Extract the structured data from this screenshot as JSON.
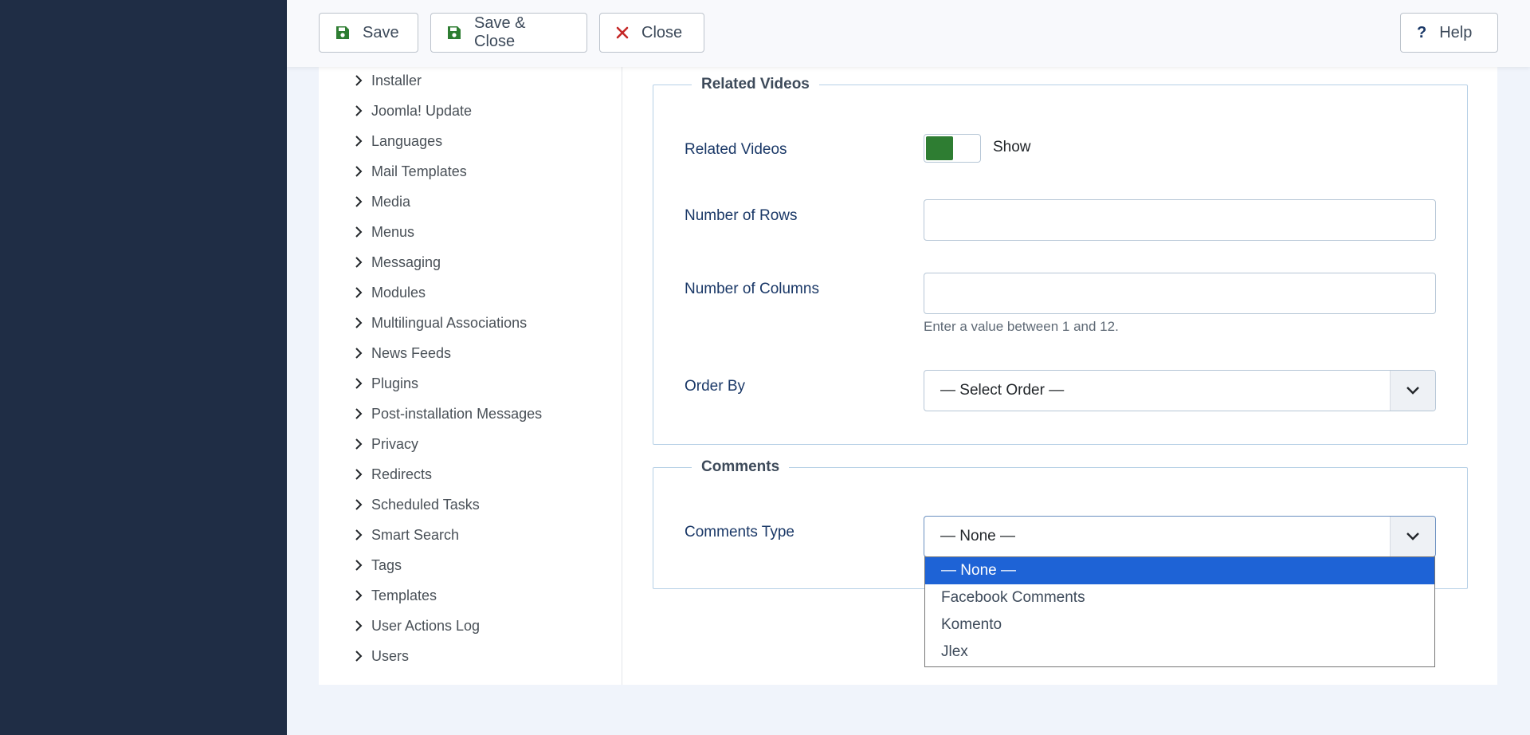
{
  "toolbar": {
    "save_label": "Save",
    "save_close_label": "Save & Close",
    "close_label": "Close",
    "help_label": "Help"
  },
  "sidebar": {
    "items": [
      {
        "label": "Installer"
      },
      {
        "label": "Joomla! Update"
      },
      {
        "label": "Languages"
      },
      {
        "label": "Mail Templates"
      },
      {
        "label": "Media"
      },
      {
        "label": "Menus"
      },
      {
        "label": "Messaging"
      },
      {
        "label": "Modules"
      },
      {
        "label": "Multilingual Associations"
      },
      {
        "label": "News Feeds"
      },
      {
        "label": "Plugins"
      },
      {
        "label": "Post-installation Messages"
      },
      {
        "label": "Privacy"
      },
      {
        "label": "Redirects"
      },
      {
        "label": "Scheduled Tasks"
      },
      {
        "label": "Smart Search"
      },
      {
        "label": "Tags"
      },
      {
        "label": "Templates"
      },
      {
        "label": "User Actions Log"
      },
      {
        "label": "Users"
      }
    ]
  },
  "related": {
    "legend": "Related Videos",
    "related_label": "Related Videos",
    "toggle_state": "Show",
    "rows_label": "Number of Rows",
    "rows_value": "",
    "columns_label": "Number of Columns",
    "columns_value": "",
    "columns_hint": "Enter a value between 1 and 12.",
    "order_label": "Order By",
    "order_value": "— Select Order —"
  },
  "comments": {
    "legend": "Comments",
    "type_label": "Comments Type",
    "type_value": "— None —",
    "options": [
      "— None —",
      "Facebook Comments",
      "Komento",
      "Jlex"
    ],
    "selected_index": 0
  },
  "colors": {
    "rail": "#1f2d45",
    "save_icon": "#2e7d32",
    "close_icon": "#c52827",
    "help_icon": "#1a3867",
    "toggle_on": "#2e7d32",
    "option_selected": "#1e63d6"
  },
  "icons": {
    "save": "floppy-disk-icon",
    "close": "x-icon",
    "help": "question-mark-icon",
    "tree": "chevron-right-icon",
    "select": "chevron-down-icon"
  }
}
